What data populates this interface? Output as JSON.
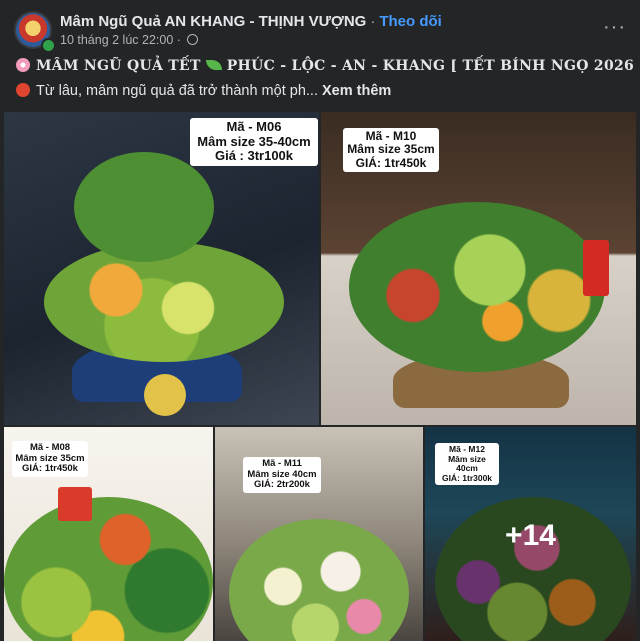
{
  "post": {
    "page_name": "Mâm Ngũ Quả AN KHANG - THỊNH VƯỢNG",
    "separator": "·",
    "follow_label": "Theo dõi",
    "timestamp": "10 tháng 2 lúc 22:00",
    "dot": "·",
    "more_label": "···",
    "headline": {
      "part1": "MÂM NGŨ QUẢ TẾT",
      "part2": "PHÚC - LỘC - AN - KHANG [ TẾT BÍNH NGỌ 2026 ]"
    },
    "body_text": "Từ lâu, mâm ngũ quả đã trở thành một ph...",
    "see_more": "Xem thêm"
  },
  "photos": [
    {
      "code": "Mã - M06",
      "size": "Mâm size 35-40cm",
      "price": "Giá : 3tr100k"
    },
    {
      "code": "Mã - M10",
      "size": "Mâm size 35cm",
      "price": "GIÁ:  1tr450k"
    },
    {
      "code": "Mã - M08",
      "size": "Mâm size 35cm",
      "price": "GIÁ:  1tr450k"
    },
    {
      "code": "Mã - M11",
      "size": "Mâm size 40cm",
      "price": "GIÁ:  2tr200k"
    },
    {
      "code": "Mã - M12",
      "size": "Mâm size 40cm",
      "price": "GIÁ: 1tr300k"
    }
  ],
  "more_photos": "+14",
  "icons": [
    "avatar",
    "globe-icon",
    "more-options-icon",
    "cherry-blossom-emoji",
    "leaf-emoji",
    "red-circle-emoji"
  ]
}
